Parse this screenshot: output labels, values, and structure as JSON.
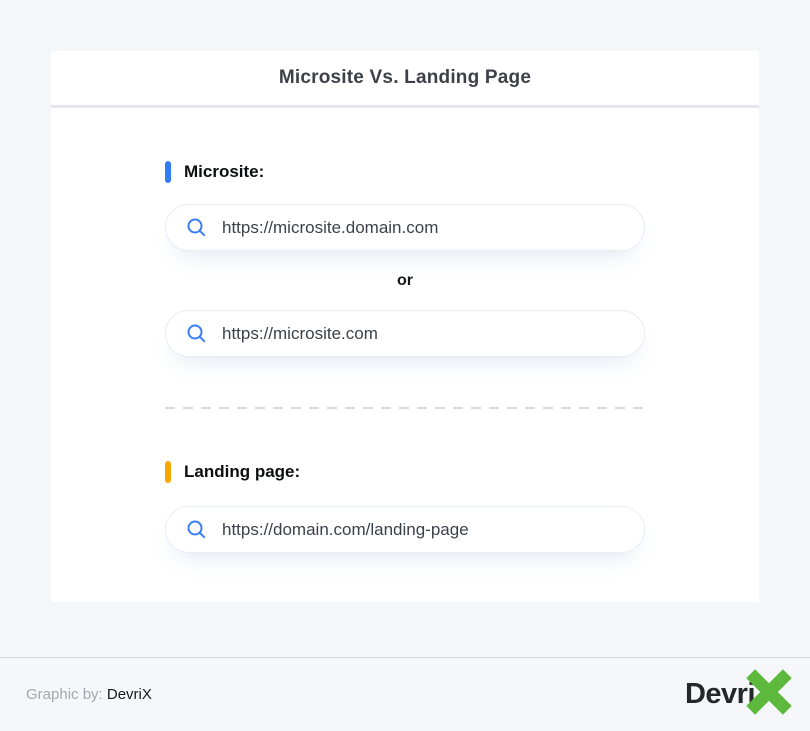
{
  "title": "Microsite Vs. Landing Page",
  "sections": [
    {
      "label": "Microsite:",
      "accent_color": "#2e7df6",
      "urls": [
        "https://microsite.domain.com",
        "https://microsite.com"
      ],
      "connector": "or"
    },
    {
      "label": "Landing page:",
      "accent_color": "#f7a801",
      "urls": [
        "https://domain.com/landing-page"
      ]
    }
  ],
  "colors": {
    "accent_blue": "#2e7df6",
    "accent_orange": "#f7a801",
    "search_icon_blue": "#3b7df2",
    "logo_green": "#5cb93c",
    "page_background": "#f4f6f9",
    "header_separator": "#e4e7f2"
  },
  "footer": {
    "credit_prefix": "Graphic by:",
    "credit_name": "DevriX",
    "logo_text": "Devri",
    "logo_x": "X"
  }
}
